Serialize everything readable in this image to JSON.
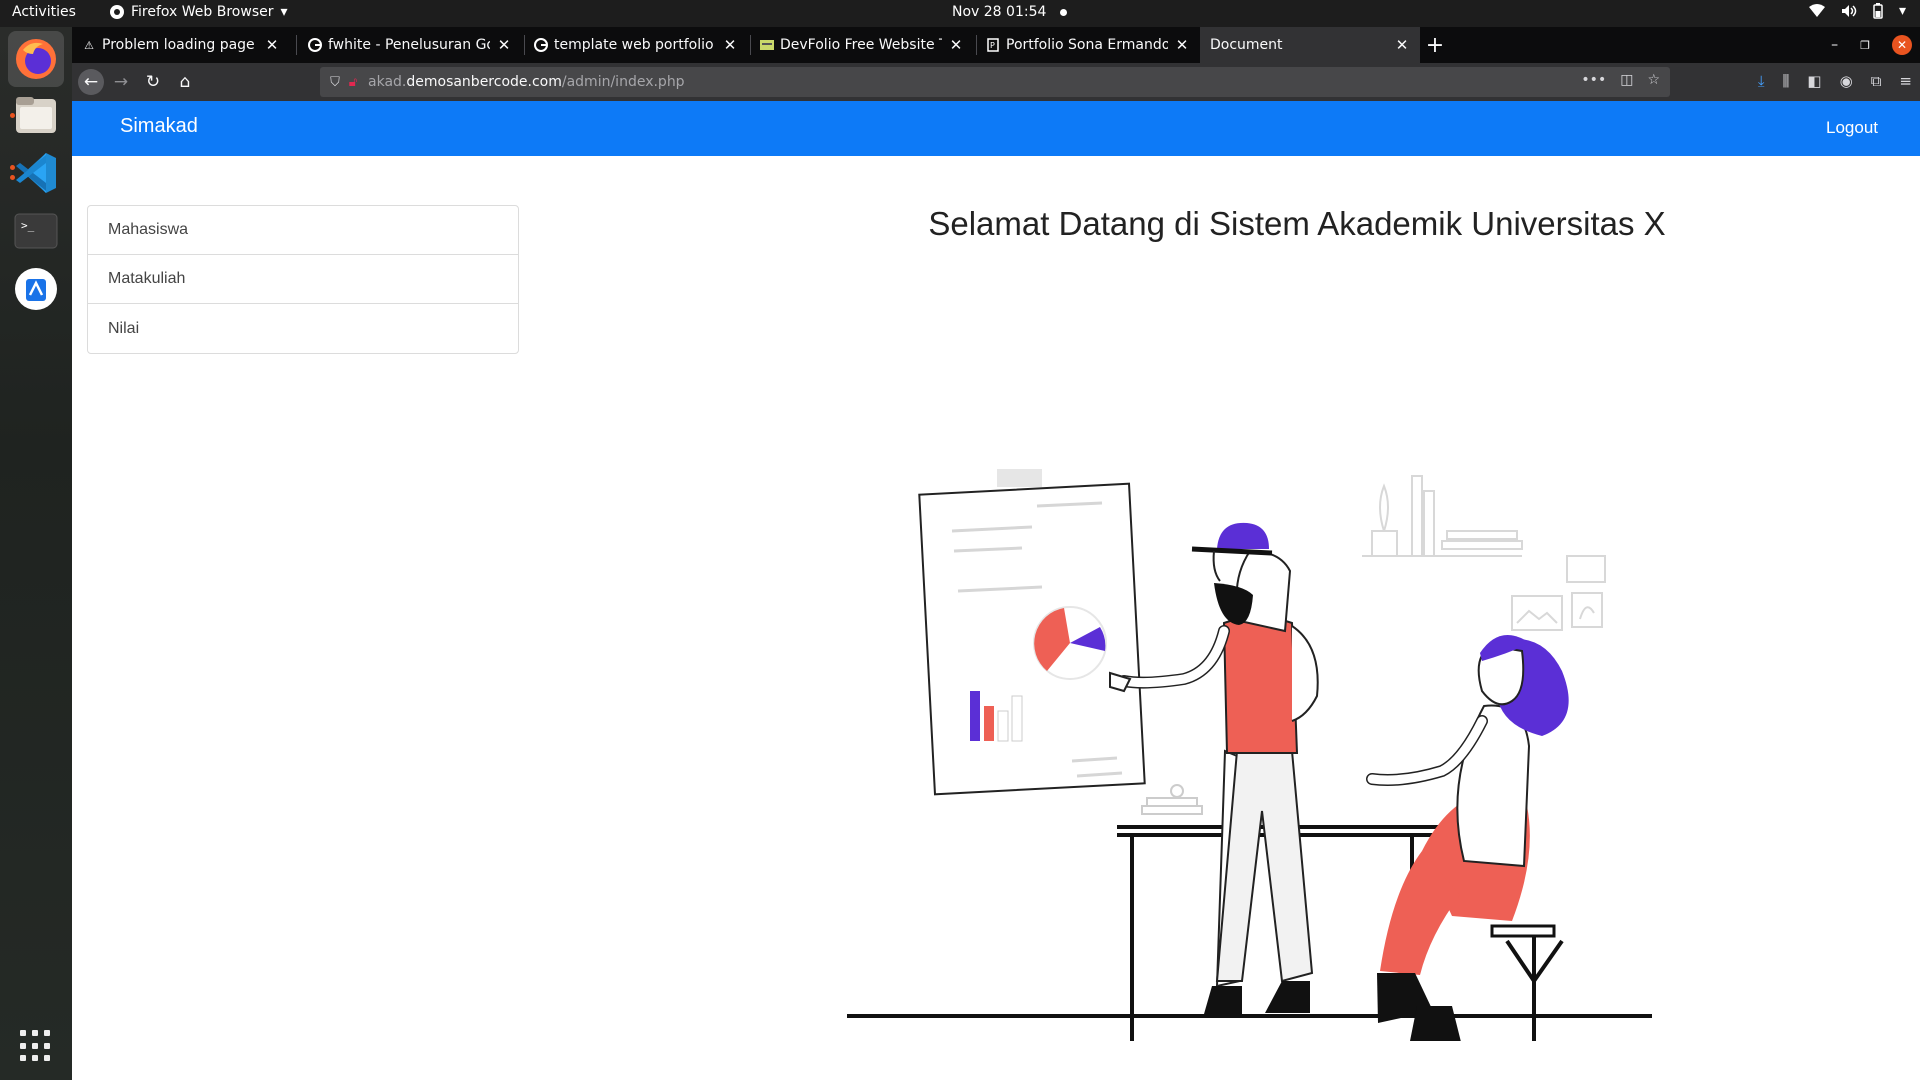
{
  "system": {
    "activities": "Activities",
    "app_name": "Firefox Web Browser",
    "clock": "Nov 28  01:54"
  },
  "browser": {
    "tabs": [
      {
        "title": "Problem loading page",
        "icon": "warning-icon"
      },
      {
        "title": "fwhite - Penelusuran Google",
        "icon": "google-icon"
      },
      {
        "title": "template web portfolio - Penelusuran Google",
        "icon": "google-icon"
      },
      {
        "title": "DevFolio Free Website Template",
        "icon": "site-icon"
      },
      {
        "title": "Portfolio Sona Ermando",
        "icon": "page-icon"
      },
      {
        "title": "Document",
        "icon": "none"
      }
    ],
    "url_prefix": "akad.",
    "url_host": "demosanbercode.com",
    "url_path": "/admin/index.php"
  },
  "site": {
    "brand": "Simakad",
    "logout_label": "Logout",
    "sidebar": [
      "Mahasiswa",
      "Matakuliah",
      "Nilai"
    ],
    "welcome": "Selamat Datang di Sistem Akademik Universitas X"
  },
  "colors": {
    "navbar": "#0d7af7",
    "accent_red": "#ee6055",
    "accent_purple": "#5b2fd6"
  }
}
